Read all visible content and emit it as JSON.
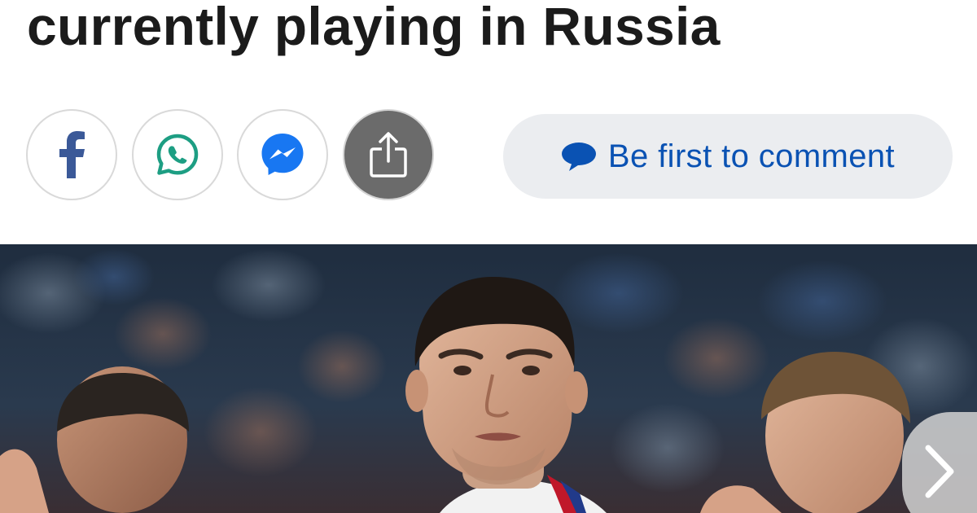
{
  "article": {
    "headline": "currently playing in Russia"
  },
  "share": {
    "buttons": [
      {
        "name": "facebook",
        "icon": "facebook-icon",
        "color": "#3b5998"
      },
      {
        "name": "whatsapp",
        "icon": "whatsapp-icon",
        "color": "#1d9e83"
      },
      {
        "name": "messenger",
        "icon": "messenger-icon",
        "color": "#1877f2"
      },
      {
        "name": "share",
        "icon": "share-upload-icon",
        "color": "#ffffff"
      }
    ],
    "comment_label": "Be first to comment",
    "comment_icon": "speech-bubble-icon",
    "comment_color": "#0a52b3"
  },
  "gallery": {
    "next_icon": "chevron-right-icon"
  },
  "colors": {
    "headline": "#1b1b1b",
    "comment_bg": "#ebedf0",
    "native_share_bg": "#6b6b6b"
  }
}
